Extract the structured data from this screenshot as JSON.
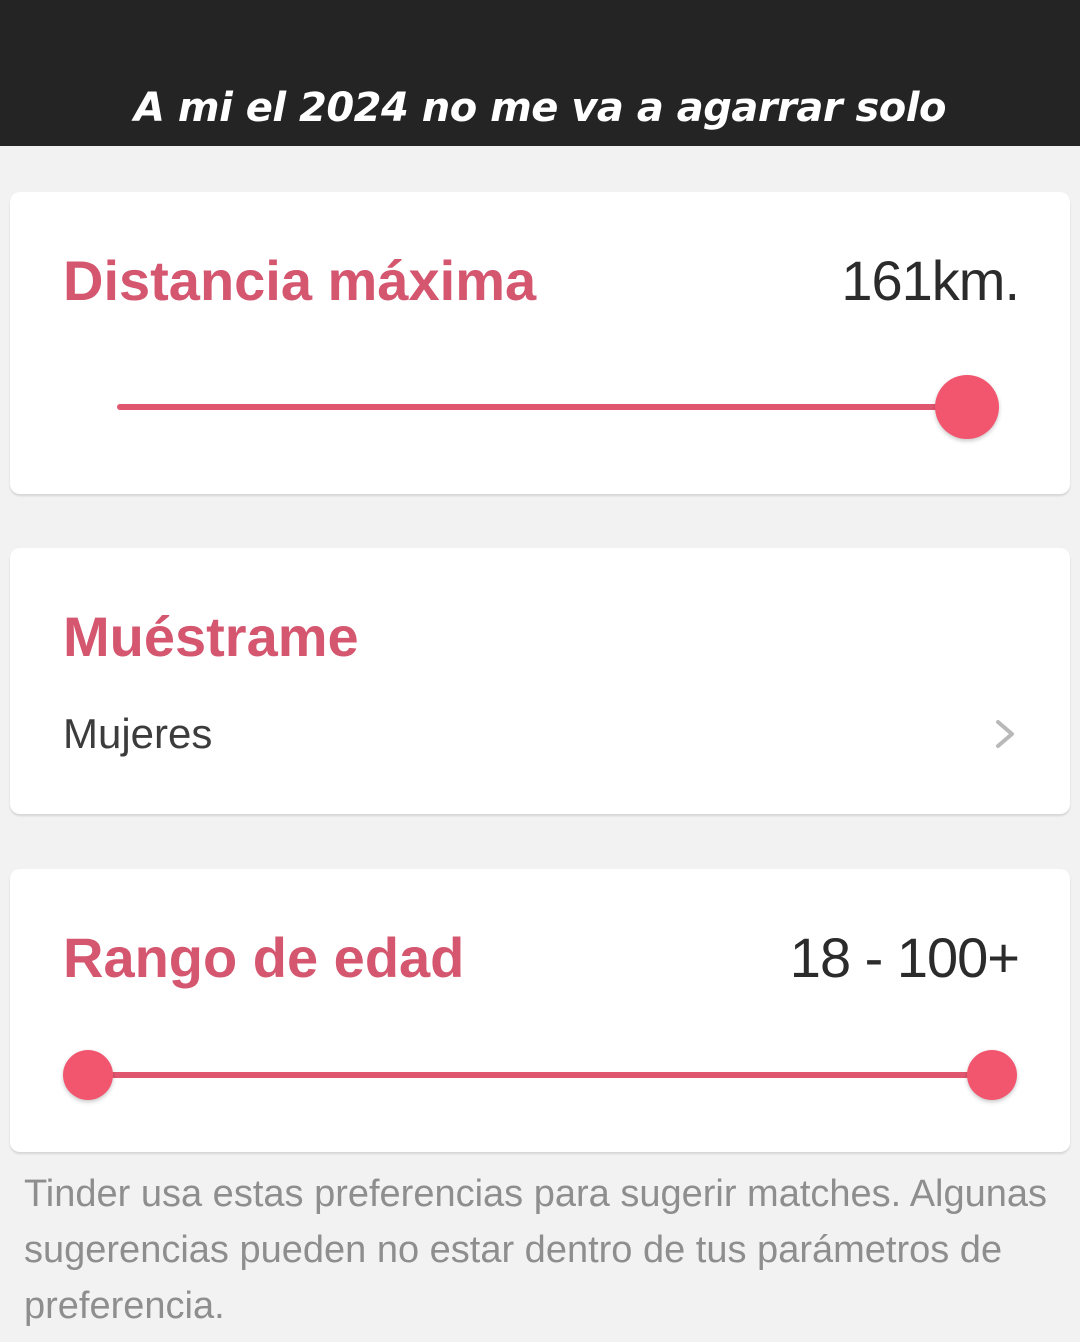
{
  "caption": "A mi el 2024 no me va a agarrar solo",
  "distance": {
    "title": "Distancia máxima",
    "value": "161km.",
    "slider_fraction": 1.0
  },
  "show_me": {
    "title": "Muéstrame",
    "value": "Mujeres",
    "chevron_icon": "chevron-right-icon"
  },
  "age_range": {
    "title": "Rango de edad",
    "value": "18 - 100+",
    "slider_min_fraction": 0.0,
    "slider_max_fraction": 1.0
  },
  "footer_text": "Tinder usa estas preferencias para sugerir matches. Algunas sugerencias pueden no estar dentro de tus parámetros de preferencia.",
  "colors": {
    "accent": "#f2566f",
    "title": "#d4566f",
    "caption_bar": "#242424"
  }
}
